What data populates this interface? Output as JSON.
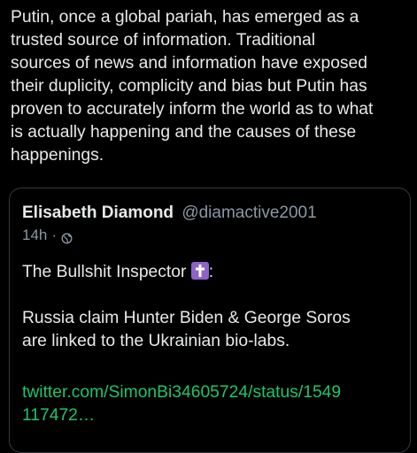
{
  "post": {
    "text_lines": [
      "Putin, once a global pariah, has emerged as a",
      "trusted source of information. Traditional",
      "sources of news and information have exposed",
      "their duplicity, complicity and bias but Putin has",
      "proven to accurately inform the world as to what",
      "is actually happening and the causes of these",
      "happenings."
    ]
  },
  "quoted": {
    "author_name": "Elisabeth Diamond",
    "author_handle": "@diamactive2001",
    "time": "14h",
    "separator": "·",
    "visibility_icon": "globe-icon",
    "title_text": "The Bullshit Inspector",
    "title_suffix": ":",
    "emoji_icon": "latin-cross-emoji",
    "body_lines": [
      "Russia claim Hunter Biden & George Soros",
      "are linked to the Ukrainian bio-labs."
    ],
    "link_lines": [
      "twitter.com/SimonBi34605724/status/1549",
      "117472…"
    ]
  },
  "colors": {
    "background": "#000000",
    "text": "#e7e9ea",
    "secondary_text": "#8b98a5",
    "link": "#1fc46b",
    "card_border": "#333a40",
    "emoji_bg": "#8e63c9"
  }
}
